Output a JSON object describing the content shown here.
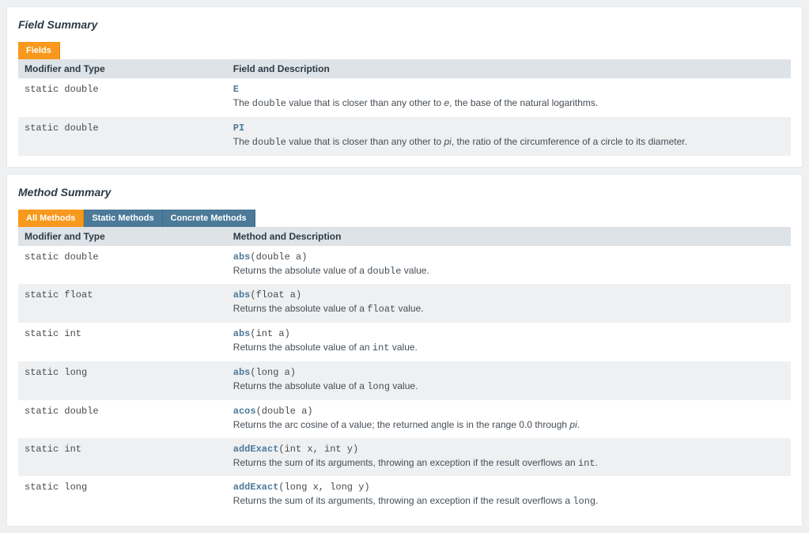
{
  "fieldSummary": {
    "title": "Field Summary",
    "tabs": [
      {
        "label": "Fields",
        "active": true
      }
    ],
    "columns": {
      "col1": "Modifier and Type",
      "col2": "Field and Description"
    },
    "rows": [
      {
        "modifier": "static double",
        "name": "E",
        "desc_before": "The ",
        "desc_code1": "double",
        "desc_mid": " value that is closer than any other to ",
        "desc_em": "e",
        "desc_after": ", the base of the natural logarithms."
      },
      {
        "modifier": "static double",
        "name": "PI",
        "desc_before": "The ",
        "desc_code1": "double",
        "desc_mid": " value that is closer than any other to ",
        "desc_em": "pi",
        "desc_after": ", the ratio of the circumference of a circle to its diameter."
      }
    ]
  },
  "methodSummary": {
    "title": "Method Summary",
    "tabs": [
      {
        "label": "All Methods",
        "active": true
      },
      {
        "label": "Static Methods",
        "active": false
      },
      {
        "label": "Concrete Methods",
        "active": false
      }
    ],
    "columns": {
      "col1": "Modifier and Type",
      "col2": "Method and Description"
    },
    "rows": [
      {
        "modifier": "static double",
        "name": "abs",
        "params": "(double a)",
        "desc_before": "Returns the absolute value of a ",
        "desc_code1": "double",
        "desc_after": " value."
      },
      {
        "modifier": "static float",
        "name": "abs",
        "params": "(float a)",
        "desc_before": "Returns the absolute value of a ",
        "desc_code1": "float",
        "desc_after": " value."
      },
      {
        "modifier": "static int",
        "name": "abs",
        "params": "(int a)",
        "desc_before": "Returns the absolute value of an ",
        "desc_code1": "int",
        "desc_after": " value."
      },
      {
        "modifier": "static long",
        "name": "abs",
        "params": "(long a)",
        "desc_before": "Returns the absolute value of a ",
        "desc_code1": "long",
        "desc_after": " value."
      },
      {
        "modifier": "static double",
        "name": "acos",
        "params": "(double a)",
        "desc_before": "Returns the arc cosine of a value; the returned angle is in the range 0.0 through ",
        "desc_em": "pi",
        "desc_after": "."
      },
      {
        "modifier": "static int",
        "name": "addExact",
        "params": "(int x, int y)",
        "desc_before": "Returns the sum of its arguments, throwing an exception if the result overflows an ",
        "desc_code1": "int",
        "desc_after": "."
      },
      {
        "modifier": "static long",
        "name": "addExact",
        "params": "(long x, long y)",
        "desc_before": "Returns the sum of its arguments, throwing an exception if the result overflows a ",
        "desc_code1": "long",
        "desc_after": "."
      }
    ]
  }
}
